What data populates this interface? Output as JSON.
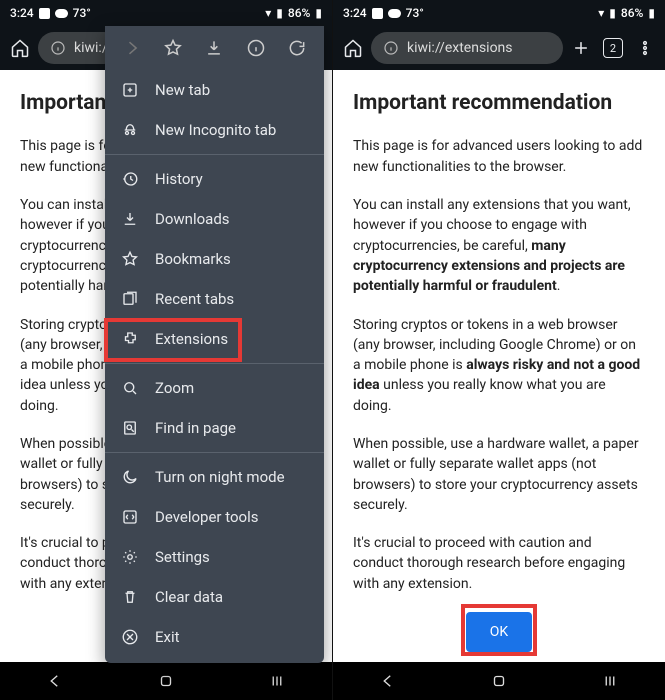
{
  "status": {
    "time": "3:24",
    "temp": "73°",
    "battery": "86%"
  },
  "left_phone": {
    "url": "kiwi:/",
    "heading_visible": "Important",
    "paragraphs_visible": [
      "This page is for advanced users looking to add new functionalities to the browser.",
      "You can install any extensions that you want, however if you choose to engage with cryptocurrencies, be careful, many cryptocurrency extensions and projects are potentially harmful or fraudulent.",
      "Storing cryptos or tokens in a web browser (any browser, including Google Chrome) or on a mobile phone is always risky and not a good idea unless you really know what you are doing.",
      "When possible, use a hardware wallet, a paper wallet or fully separate wallet apps (not browsers) to store your cryptocurrency assets securely.",
      "It's crucial to proceed with caution and conduct thorough research before engaging with any extension."
    ],
    "menu": {
      "items": [
        "New tab",
        "New Incognito tab",
        "History",
        "Downloads",
        "Bookmarks",
        "Recent tabs",
        "Extensions",
        "Zoom",
        "Find in page",
        "Turn on night mode",
        "Developer tools",
        "Settings",
        "Clear data",
        "Exit"
      ],
      "highlighted": "Extensions"
    }
  },
  "right_phone": {
    "url": "kiwi://extensions",
    "tab_count": "2",
    "heading": "Important recommendation",
    "p1_a": "This page is for advanced users looking to add new functionalities to the browser.",
    "p2_a": "You can install any extensions that you want, however if you choose to engage with cryptocurrencies, be careful, ",
    "p2_b": "many cryptocurrency extensions and projects are potentially harmful or fraudulent",
    "p2_c": ".",
    "p3_a": "Storing cryptos or tokens in a web browser (any browser, including Google Chrome) or on a mobile phone is ",
    "p3_b": "always risky and not a good idea",
    "p3_c": " unless you really know what you are doing.",
    "p4": "When possible, use a hardware wallet, a paper wallet or fully separate wallet apps (not browsers) to store your cryptocurrency assets securely.",
    "p5": "It's crucial to proceed with caution and conduct thorough research before engaging with any extension.",
    "ok_label": "OK"
  }
}
